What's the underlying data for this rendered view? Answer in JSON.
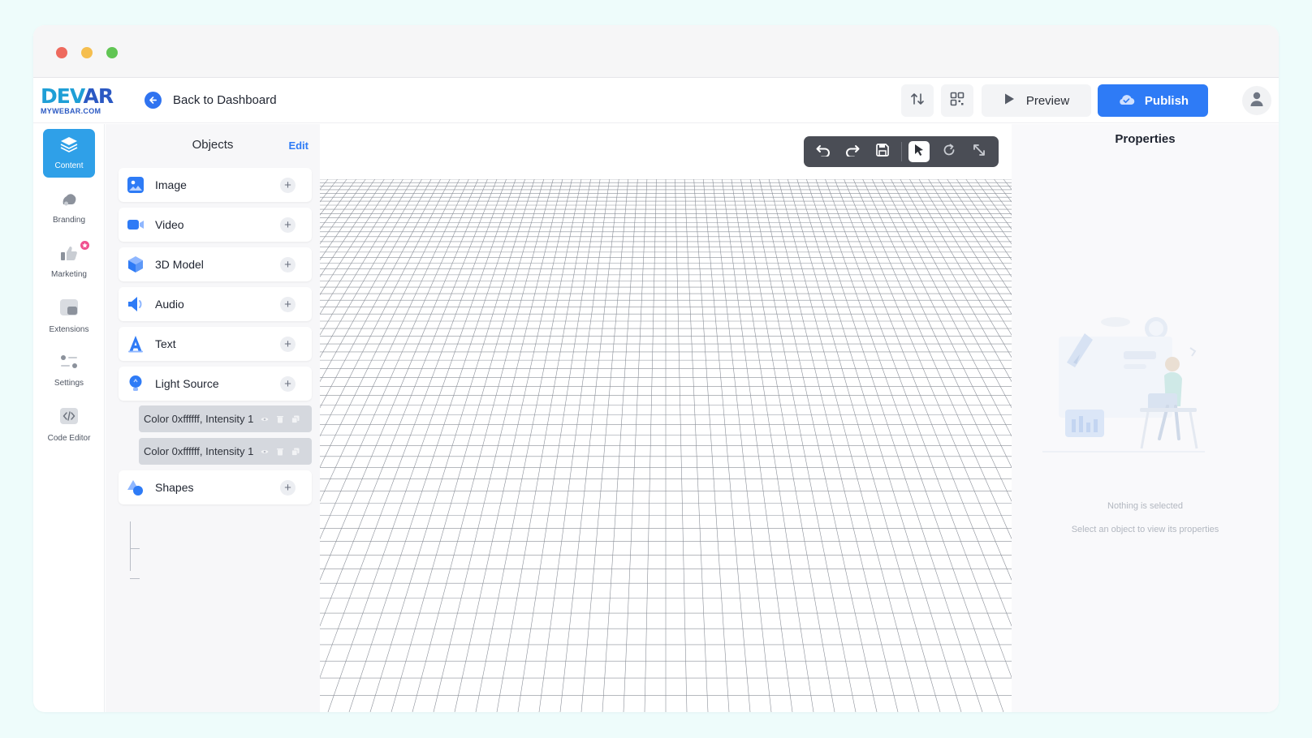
{
  "app": {
    "logo_main_a": "DEV",
    "logo_main_b": "AR",
    "logo_sub": "MYWEBAR.COM"
  },
  "header": {
    "back_label": "Back to Dashboard",
    "preview_label": "Preview",
    "publish_label": "Publish",
    "accent": "#2e7bf6"
  },
  "nav": {
    "items": [
      {
        "label": "Content",
        "icon": "layers-icon",
        "active": true
      },
      {
        "label": "Branding",
        "icon": "branding-icon"
      },
      {
        "label": "Marketing",
        "icon": "thumbs-up-icon"
      },
      {
        "label": "Extensions",
        "icon": "extensions-icon"
      },
      {
        "label": "Settings",
        "icon": "sliders-icon"
      },
      {
        "label": "Code Editor",
        "icon": "code-icon"
      }
    ]
  },
  "objects": {
    "title": "Objects",
    "edit_label": "Edit",
    "items": [
      {
        "label": "Image",
        "icon": "image-icon"
      },
      {
        "label": "Video",
        "icon": "video-icon"
      },
      {
        "label": "3D Model",
        "icon": "cube-icon"
      },
      {
        "label": "Audio",
        "icon": "speaker-icon"
      },
      {
        "label": "Text",
        "icon": "text-icon"
      },
      {
        "label": "Light Source",
        "icon": "bulb-icon"
      },
      {
        "label": "Shapes",
        "icon": "shapes-icon"
      }
    ],
    "light_children": [
      {
        "label": "Color 0xffffff, Intensity 1"
      },
      {
        "label": "Color 0xffffff, Intensity 1"
      }
    ]
  },
  "canvas": {
    "toolbar": [
      "undo-icon",
      "redo-icon",
      "save-icon",
      "select-pointer-icon",
      "rotate-icon",
      "scale-icon"
    ],
    "active_tool": "select-pointer-icon"
  },
  "properties": {
    "title": "Properties",
    "empty_title": "Nothing is selected",
    "empty_hint": "Select an object to view its properties"
  }
}
